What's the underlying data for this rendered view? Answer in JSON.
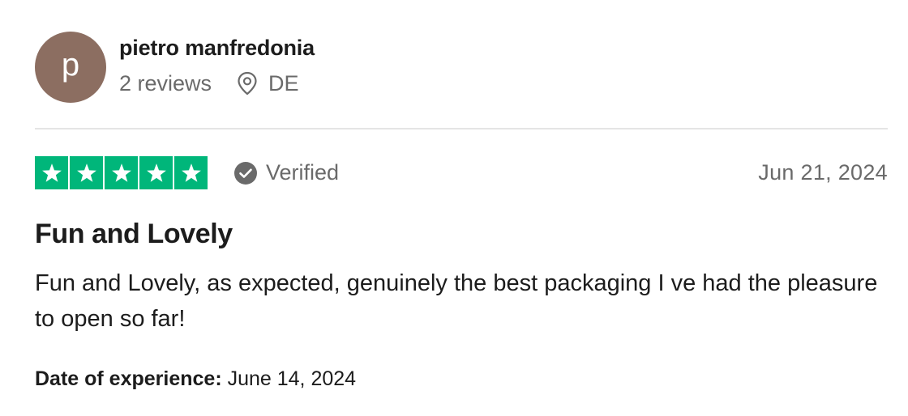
{
  "reviewer": {
    "avatar_letter": "p",
    "avatar_color": "#8c6e61",
    "name": "pietro manfredonia",
    "reviews_count": "2 reviews",
    "location": "DE"
  },
  "rating": {
    "stars": 5,
    "max_stars": 5,
    "star_color": "#00b67a",
    "verified_label": "Verified",
    "date": "Jun 21, 2024"
  },
  "review": {
    "title": "Fun and Lovely",
    "body": "Fun and Lovely, as expected, genuinely the best packaging I ve had the pleasure to open so far!"
  },
  "experience": {
    "label": "Date of experience:",
    "value": "June 14, 2024"
  }
}
